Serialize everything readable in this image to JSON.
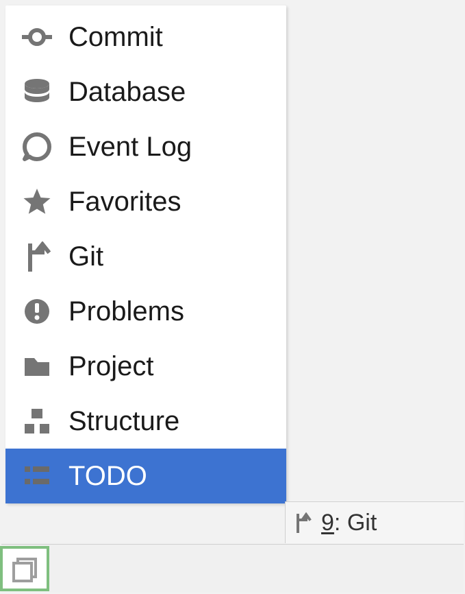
{
  "popup": {
    "items": [
      {
        "icon": "commit-icon",
        "label": "Commit",
        "selected": false
      },
      {
        "icon": "database-icon",
        "label": "Database",
        "selected": false
      },
      {
        "icon": "event-log-icon",
        "label": "Event Log",
        "selected": false
      },
      {
        "icon": "favorites-icon",
        "label": "Favorites",
        "selected": false
      },
      {
        "icon": "git-icon",
        "label": "Git",
        "selected": false
      },
      {
        "icon": "problems-icon",
        "label": "Problems",
        "selected": false
      },
      {
        "icon": "project-icon",
        "label": "Project",
        "selected": false
      },
      {
        "icon": "structure-icon",
        "label": "Structure",
        "selected": false
      },
      {
        "icon": "todo-icon",
        "label": "TODO",
        "selected": true
      }
    ]
  },
  "toolbar": {
    "git_mnemonic": "9",
    "git_label_rest": ": Git"
  },
  "icon_colors": {
    "normal": "#757575",
    "selected": "#6a6a6a",
    "highlight_border": "#7fbf7f"
  }
}
